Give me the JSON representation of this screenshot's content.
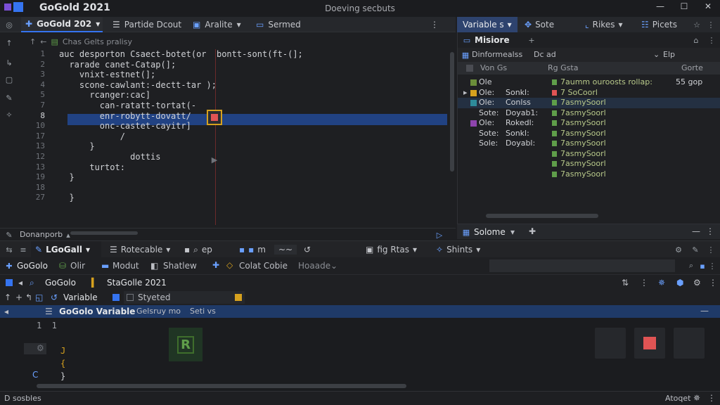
{
  "titlebar": {
    "app_title": "GoGold 2021",
    "window_title": "Doeving secbuts",
    "minimize": "—",
    "maximize": "☐",
    "close": "✕"
  },
  "editor_tabs": {
    "tab1": "GoGold 202",
    "tab1_arrow": "▾",
    "tab2": "Partide Dcout",
    "tab3": "Aralite",
    "tab3_arrow": "▾",
    "tab4": "Sermed",
    "more": "⋮"
  },
  "breadcrumb": "Chas Gelts pralisy",
  "gutter": [
    "1",
    "2",
    "3",
    "4",
    "5",
    "7",
    "8",
    "10",
    "17",
    "13",
    "12",
    "13",
    "19",
    "18",
    "27"
  ],
  "code": [
    "auc desporton Csaect-botet(or  bontt-sont(ft-(];",
    "  rarade canet-Catap(];",
    "    vnixt-estnet(];",
    "    scone-cawlant:-dectt-tar );",
    "      rcanger:cac]",
    "        can-ratatt-tortat(-",
    "        enr-robytt-dovatt/",
    "        onc-castet-cayitr]",
    "            /",
    "      }",
    "              dottis",
    "      turtot:",
    "  }",
    "",
    "  }"
  ],
  "right_tabs": {
    "variables": "Variable s",
    "variables_arrow": "▾",
    "sote": "Sote",
    "rikes": "Rikes",
    "rikes_arrow": "▾",
    "picets": "Picets"
  },
  "right_panel": {
    "title": "Misiore",
    "filter_label": "Dinformealss",
    "filter_value": "Dc ad",
    "filter_right": "Elp",
    "col1": "Von Gs",
    "col2": "Rg Gsta",
    "col3": "Gorte",
    "rows": [
      {
        "a": "Ole",
        "b": "",
        "c": "7aumm ouroosts rollap:",
        "d": "55 gop",
        "color": "#6b8e3a"
      },
      {
        "a": "Ole:",
        "b": "Sonkl:",
        "c": "7 SoCoorl",
        "d": "",
        "color": "#d6a11e"
      },
      {
        "a": "Ole:",
        "b": "Conlss",
        "c": "7asmySoorl",
        "d": "",
        "color": "#2e8b9a"
      },
      {
        "a": "Sote:",
        "b": "Doyab1:",
        "c": "7asmySoorl",
        "d": "",
        "color": ""
      },
      {
        "a": "Ole:",
        "b": "Rokedl:",
        "c": "7asmySoorl",
        "d": "",
        "color": "#8e44ad"
      },
      {
        "a": "Sote:",
        "b": "Sonkl:",
        "c": "7asmySoorl",
        "d": "",
        "color": ""
      },
      {
        "a": "Sole:",
        "b": "Doyabl:",
        "c": "7asmySoorl",
        "d": "",
        "color": ""
      },
      {
        "a": "",
        "b": "",
        "c": "7asmySoorl",
        "d": "",
        "color": ""
      },
      {
        "a": "",
        "b": "",
        "c": "7asmySoorl",
        "d": "",
        "color": ""
      },
      {
        "a": "",
        "b": "",
        "c": "7asmySoorl",
        "d": "",
        "color": ""
      }
    ],
    "bottom_tab": "Solome",
    "bottom_tab_arrow": "▾"
  },
  "separator": {
    "label": "Donanporb"
  },
  "debug": {
    "tab_main": "LGoGall",
    "tab_main_arrow": "▾",
    "tab_rotate": "Rotecable",
    "tab_rotate_arrow": "▾",
    "tab_ep": "ep",
    "tab_m": "m",
    "tab_fig": "fig Rtas",
    "tab_fig_arrow": "▾",
    "tab_shints": "Shints",
    "tab_shints_arrow": "▾",
    "tool_gogolo": "GoGolo",
    "tool_olir": "Olir",
    "tool_modut": "Modut",
    "tool_shatlew": "Shatlew",
    "tool_color": "Colat Cobie",
    "tool_hoaade": "Hoaade",
    "frame_name": "GoGolo",
    "frame_state": "StaGolle 2021",
    "vars_label": "Variable",
    "vars_dropdown": "Styeted",
    "sel_title": "GoGolo Variable",
    "sel_sub": "Gelsruy mo",
    "sel_extra": "Seti vs",
    "body_lines": [
      "1  1",
      "",
      "J",
      "{",
      "}"
    ],
    "tile_letter": "R"
  },
  "statusbar": {
    "left": "D sosbles",
    "right": "Atoqet"
  },
  "colors": {
    "accent": "#3574f0",
    "selection": "#214283",
    "breakpoint": "#e05454"
  }
}
